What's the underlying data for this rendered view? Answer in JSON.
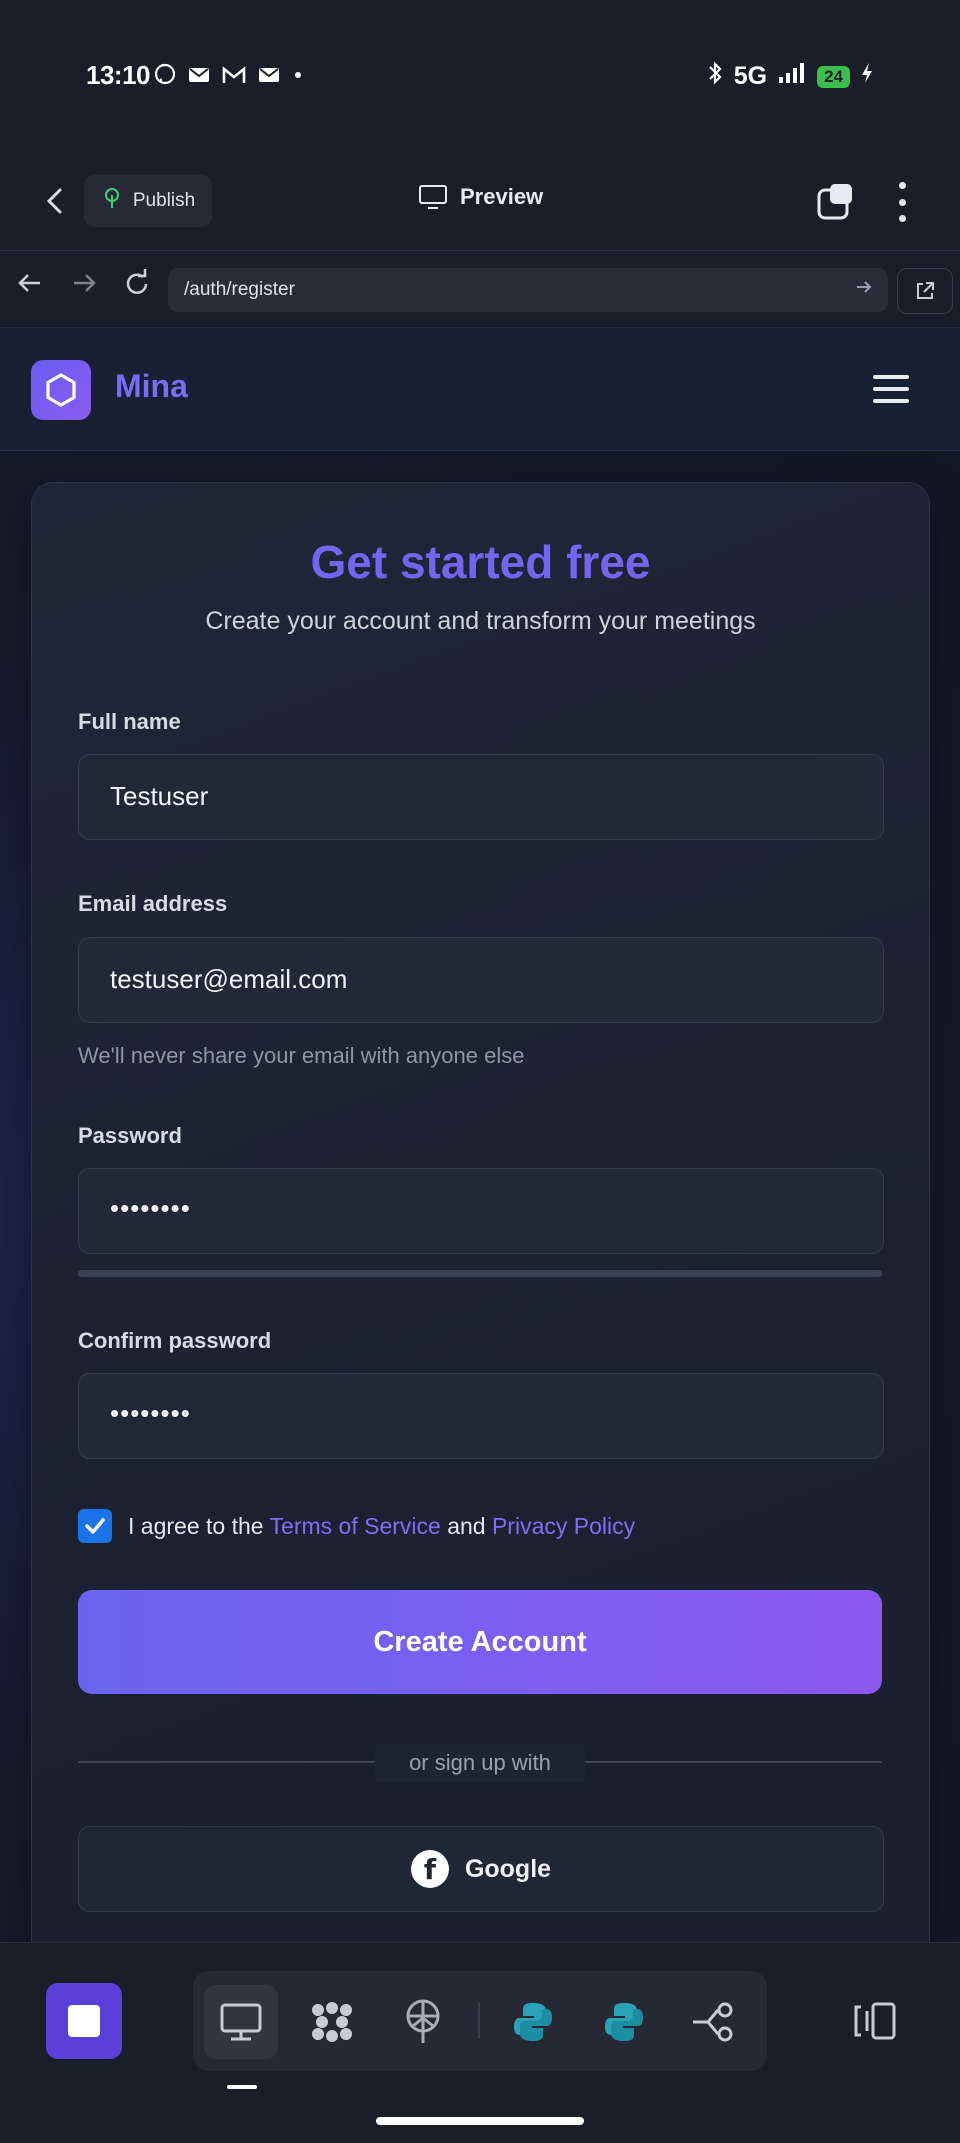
{
  "status_bar": {
    "time": "13:10",
    "network": "5G",
    "battery": "24",
    "notification_icons": [
      "whatsapp-icon",
      "mail-icon",
      "gmail-icon",
      "mail-icon",
      "dot-icon"
    ]
  },
  "app_bar": {
    "publish_label": "Publish",
    "preview_label": "Preview"
  },
  "browser": {
    "url": "/auth/register"
  },
  "site": {
    "brand": "Mina"
  },
  "form": {
    "title": "Get started free",
    "subtitle": "Create your account and transform your meetings",
    "full_name_label": "Full name",
    "full_name_value": "Testuser",
    "email_label": "Email address",
    "email_value": "testuser@email.com",
    "email_helper": "We'll never share your email with anyone else",
    "password_label": "Password",
    "password_value": "••••••••",
    "confirm_label": "Confirm password",
    "confirm_value": "••••••••",
    "agree_prefix": "I agree to the",
    "terms_link": "Terms of Service",
    "agree_and": "and",
    "privacy_link": "Privacy Policy",
    "agree_checked": true,
    "create_button": "Create Account",
    "divider_text": "or sign up with",
    "google_button": "Google"
  },
  "colors": {
    "accent": "#7465f0",
    "button_start": "#6b63f0",
    "button_end": "#8c58ef",
    "checkbox": "#1a73e8"
  },
  "dock": {
    "items": [
      "stop-icon",
      "desktop-icon",
      "cluster-icon",
      "deploy-icon",
      "python-icon",
      "python-icon",
      "workflow-icon",
      "panel-icon"
    ]
  }
}
